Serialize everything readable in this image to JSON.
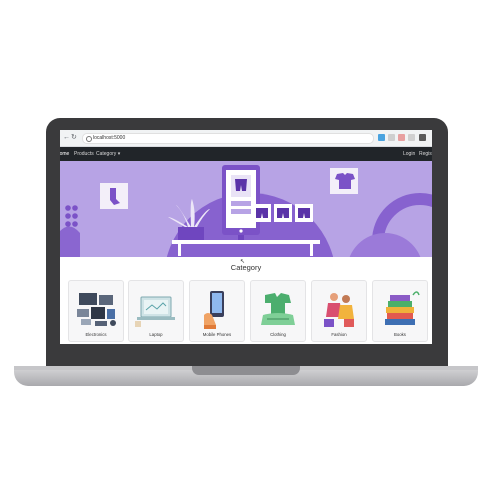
{
  "browser": {
    "url": "localhost:5000"
  },
  "navbar": {
    "home_label": "Home",
    "products_label": "Products",
    "category_label": "Category",
    "login_label": "Login",
    "register_label": "Register"
  },
  "category": {
    "title": "Category",
    "items": [
      {
        "label": "Electronics"
      },
      {
        "label": "Laptop"
      },
      {
        "label": "Mobile Phones"
      },
      {
        "label": "Clothing"
      },
      {
        "label": "Fashion"
      },
      {
        "label": "Books"
      }
    ]
  },
  "colors": {
    "banner": "#b7a3e5",
    "banner_dark": "#7b52c7",
    "navbar": "#212529",
    "laptop_frame": "#3a3a3c"
  }
}
